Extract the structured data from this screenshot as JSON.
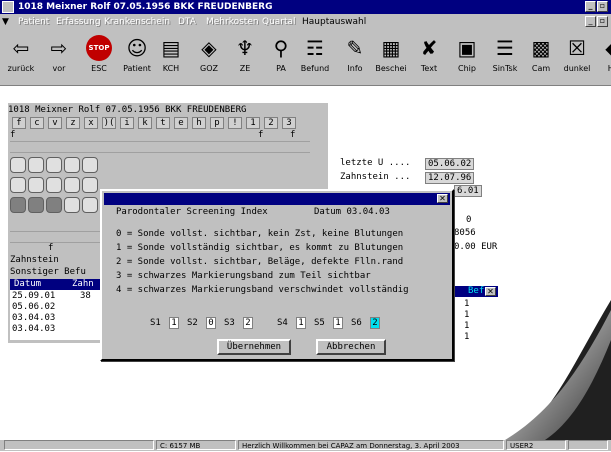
{
  "window": {
    "title": "1018 Meixner Rolf 07.05.1956 BKK FREUDENBERG"
  },
  "menu": [
    {
      "label": "Patient",
      "active": false
    },
    {
      "label": "Erfassung",
      "active": false
    },
    {
      "label": "Krankenschein",
      "active": false
    },
    {
      "label": "DTA",
      "active": false
    },
    {
      "label": "Mehrkosten",
      "active": false
    },
    {
      "label": "Quartal",
      "active": false
    },
    {
      "label": "Hauptauswahl",
      "active": true
    }
  ],
  "toolbar": [
    {
      "label": "zurück",
      "icon": "arrow-left-icon",
      "glyph": "⇦"
    },
    {
      "label": "vor",
      "icon": "arrow-right-icon",
      "glyph": "⇨"
    },
    {
      "label": "ESC",
      "icon": "stop-icon",
      "glyph": "STOP"
    },
    {
      "label": "Patient",
      "icon": "patient-icon",
      "glyph": "☺"
    },
    {
      "label": "KCH",
      "icon": "kch-icon",
      "glyph": "▤"
    },
    {
      "label": "GOZ",
      "icon": "goz-icon",
      "glyph": "◈"
    },
    {
      "label": "ZE",
      "icon": "tooth-icon",
      "glyph": "♆"
    },
    {
      "label": "PA",
      "icon": "pa-icon",
      "glyph": "⚲"
    },
    {
      "label": "Befund",
      "icon": "befund-icon",
      "glyph": "☶"
    },
    {
      "label": "Info",
      "icon": "info-icon",
      "glyph": "✎"
    },
    {
      "label": "Beschei",
      "icon": "bescheid-icon",
      "glyph": "▦"
    },
    {
      "label": "Text",
      "icon": "text-icon",
      "glyph": "✘"
    },
    {
      "label": "Chip",
      "icon": "chip-icon",
      "glyph": "▣"
    },
    {
      "label": "SinTsk",
      "icon": "list-icon",
      "glyph": "☰"
    },
    {
      "label": "Cam",
      "icon": "camera-icon",
      "glyph": "▩"
    },
    {
      "label": "dunkel",
      "icon": "dunkel-icon",
      "glyph": "☒"
    },
    {
      "label": "Hil",
      "icon": "help-icon",
      "glyph": "◆"
    }
  ],
  "panel": {
    "patient_line": "1018 Meixner Rolf 07.05.1956 BKK FREUDENBERG",
    "letters": [
      "f",
      "c",
      "v",
      "z",
      "x",
      ")(",
      "i",
      "k",
      "t",
      "e",
      "h",
      "p",
      "!",
      "1",
      "2",
      "3"
    ],
    "row_f": [
      "f",
      "f",
      "f"
    ],
    "letzte_label": "letzte U ....",
    "letzte_value": "05.06.02",
    "zahnstein_label": "Zahnstein ...",
    "zahnstein_value": "12.07.96",
    "partial_value": "6.01",
    "zero_value": "0",
    "code_value": "8056",
    "eur_value": "0.00 EUR",
    "zahnstein_side": "Zahnstein",
    "sonstiger": "Sonstiger Befu",
    "table_headers": [
      "Datum",
      "Zahn"
    ],
    "table_rows": [
      {
        "date": "25.09.01",
        "zahn": "38"
      },
      {
        "date": "05.06.02",
        "zahn": ""
      },
      {
        "date": "03.04.03",
        "zahn": ""
      },
      {
        "date": "03.04.03",
        "zahn": ""
      }
    ],
    "right_header": "Bef",
    "right_values": [
      "1",
      "1",
      "1",
      "1"
    ]
  },
  "dialog": {
    "title": "Parodontaler Screening Index",
    "date": "Datum 03.04.03",
    "lines": [
      "0 = Sonde vollst. sichtbar, kein Zst, keine Blutungen",
      "1 = Sonde vollständig sichtbar, es kommt zu Blutungen",
      "2 = Sonde vollst. sichtbar, Beläge, defekte Flln.rand",
      "3 = schwarzes Markierungsband zum Teil sichtbar",
      "4 = schwarzes Markierungsband verschwindet vollständig"
    ],
    "fields": [
      {
        "label": "S1",
        "value": "1"
      },
      {
        "label": "S2",
        "value": "0"
      },
      {
        "label": "S3",
        "value": "2"
      },
      {
        "label": "S4",
        "value": "1"
      },
      {
        "label": "S5",
        "value": "1"
      },
      {
        "label": "S6",
        "value": "2"
      }
    ],
    "ok_label": "Übernehmen",
    "cancel_label": "Abbrechen"
  },
  "status": {
    "disk": "C: 6157 MB",
    "message": "Herzlich Willkommen bei CAPAZ am Donnerstag, 3. April 2003",
    "user": "USER2"
  },
  "colors": {
    "title_bg": "#000080",
    "face": "#c0c0c0",
    "active_field": "#00e0f0"
  }
}
